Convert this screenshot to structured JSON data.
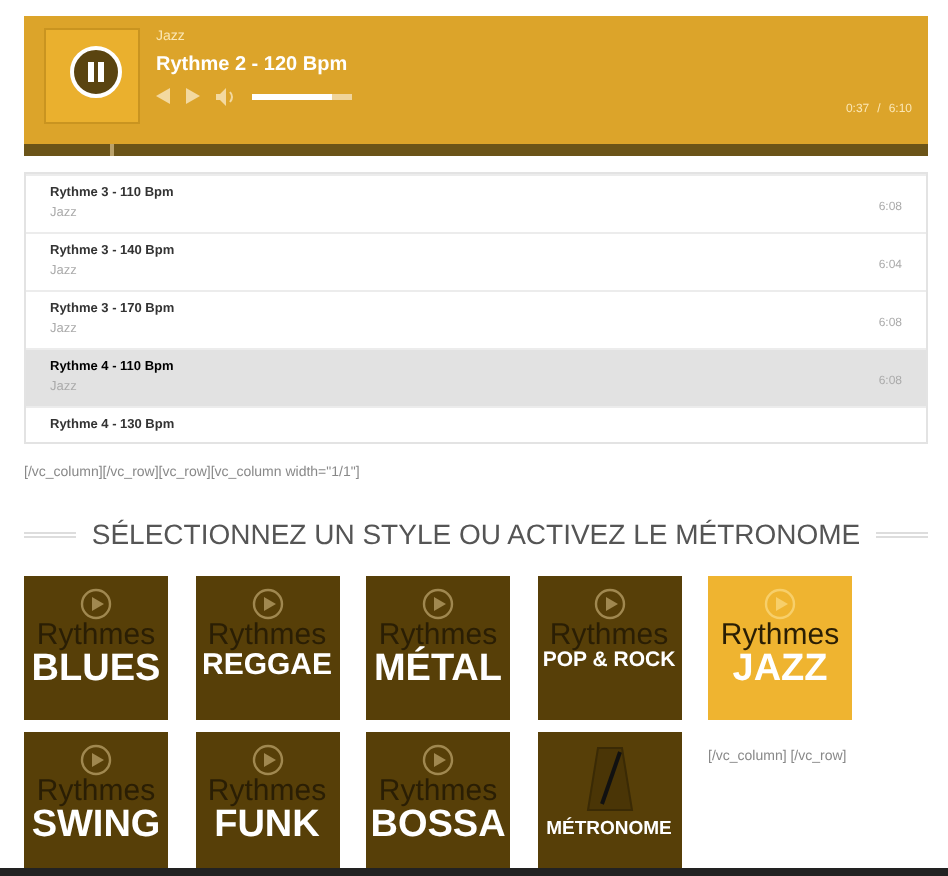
{
  "player": {
    "playing": true,
    "genre": "Jazz",
    "title": "Rythme 2 - 120 Bpm",
    "volume": {
      "level": 0.8
    },
    "elapsed": "0:37",
    "separator": "/",
    "duration": "6:10",
    "progress": {
      "level": 0.1
    }
  },
  "playlist": [
    {
      "title": "Rythme 3 - 110 Bpm",
      "genre": "Jazz",
      "duration": "6:08",
      "selected": false
    },
    {
      "title": "Rythme 3 - 140 Bpm",
      "genre": "Jazz",
      "duration": "6:04",
      "selected": false
    },
    {
      "title": "Rythme 3 - 170 Bpm",
      "genre": "Jazz",
      "duration": "6:08",
      "selected": false
    },
    {
      "title": "Rythme 4 - 110 Bpm",
      "genre": "Jazz",
      "duration": "6:08",
      "selected": true
    },
    {
      "title": "Rythme 4 - 130 Bpm",
      "selected": false
    }
  ],
  "shortcode_text": "[/vc_column][/vc_row][vc_row][vc_column width=\"1/1\"]",
  "heading": "SÉLECTIONNEZ UN STYLE OU ACTIVEZ LE MÉTRONOME",
  "tiles": [
    {
      "kind": "style",
      "line1": "Rythmes",
      "line2": "BLUES",
      "selected": false
    },
    {
      "kind": "style",
      "line1": "Rythmes",
      "line2": "REGGAE",
      "selected": false
    },
    {
      "kind": "style",
      "line1": "Rythmes",
      "line2": "MÉTAL",
      "selected": false
    },
    {
      "kind": "style",
      "line1": "Rythmes",
      "line2": "POP & ROCK",
      "selected": false
    },
    {
      "kind": "style",
      "line1": "Rythmes",
      "line2": "JAZZ",
      "selected": true
    },
    {
      "kind": "style",
      "line1": "Rythmes",
      "line2": "SWING",
      "selected": false
    },
    {
      "kind": "style",
      "line1": "Rythmes",
      "line2": "FUNK",
      "selected": false
    },
    {
      "kind": "style",
      "line1": "Rythmes",
      "line2": "BOSSA",
      "selected": false
    },
    {
      "kind": "metronome",
      "line2": "MÉTRONOME",
      "selected": false
    }
  ],
  "tiles_note": "[/vc_column] [/vc_row]"
}
